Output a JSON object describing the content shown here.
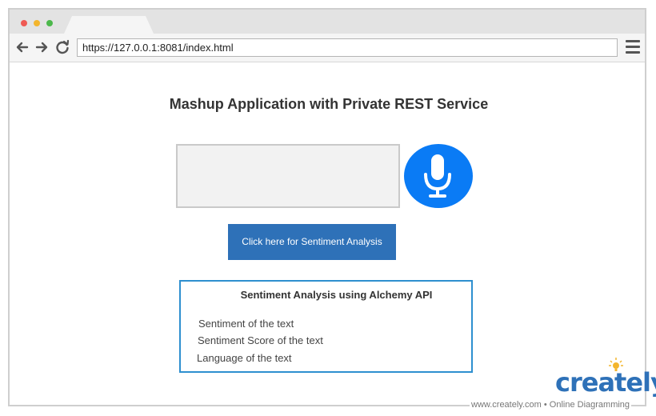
{
  "browser": {
    "url": "https://127.0.0.1:8081/index.html"
  },
  "page": {
    "title": "Mashup Application with Private REST Service",
    "speech_input_value": "",
    "sentiment_button_label": "Click here for Sentiment Analysis"
  },
  "result": {
    "title": "Sentiment Analysis using Alchemy API",
    "lines": [
      "Sentiment of the text",
      "Sentiment Score of the text",
      "Language of the text"
    ]
  },
  "branding": {
    "logo_text": "creately",
    "footer_text": "www.creately.com • Online Diagramming"
  },
  "colors": {
    "mic_blue": "#0a7bf5",
    "button_blue": "#2e71b8",
    "result_border": "#2e8fcf",
    "dot_red": "#ef5a54",
    "dot_yellow": "#f3b52d",
    "dot_green": "#4cb84b"
  },
  "icons": {
    "back": "arrow-left-icon",
    "forward": "arrow-right-icon",
    "reload": "reload-icon",
    "menu": "hamburger-menu-icon",
    "mic": "microphone-icon",
    "bulb": "lightbulb-icon"
  }
}
